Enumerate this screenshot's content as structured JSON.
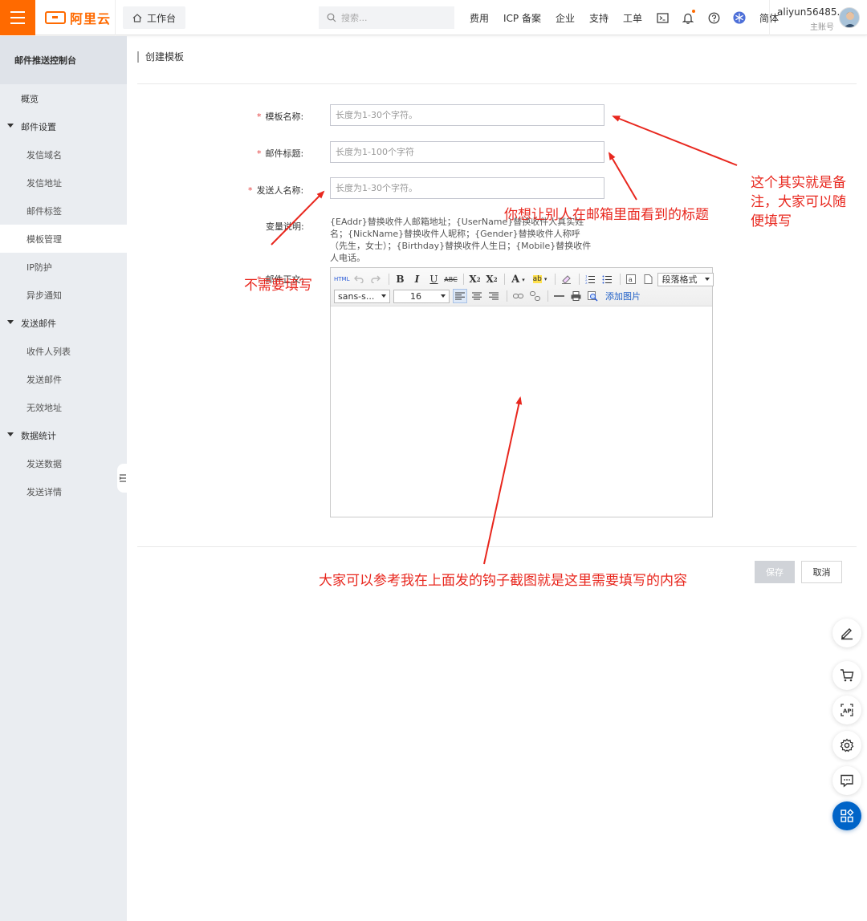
{
  "topbar": {
    "logo_text": "阿里云",
    "workbench_label": "工作台",
    "search_placeholder": "搜索...",
    "nav_links": [
      "费用",
      "ICP 备案",
      "企业",
      "支持",
      "工单"
    ],
    "lang_label": "简体",
    "user_name": "aliyun56485....",
    "user_sub": "主账号"
  },
  "sidebar": {
    "title": "邮件推送控制台",
    "items": [
      {
        "label": "概览"
      },
      {
        "label": "邮件设置"
      },
      {
        "label": "发信域名"
      },
      {
        "label": "发信地址"
      },
      {
        "label": "邮件标签"
      },
      {
        "label": "模板管理"
      },
      {
        "label": "IP防护"
      },
      {
        "label": "异步通知"
      },
      {
        "label": "发送邮件"
      },
      {
        "label": "收件人列表"
      },
      {
        "label": "发送邮件"
      },
      {
        "label": "无效地址"
      },
      {
        "label": "数据统计"
      },
      {
        "label": "发送数据"
      },
      {
        "label": "发送详情"
      }
    ]
  },
  "page": {
    "title": "创建模板"
  },
  "form": {
    "required_mark": "*",
    "template_name": {
      "label": "模板名称:",
      "placeholder": "长度为1-30个字符。"
    },
    "subject": {
      "label": "邮件标题:",
      "placeholder": "长度为1-100个字符"
    },
    "sender_name": {
      "label": "发送人名称:",
      "placeholder": "长度为1-30个字符。"
    },
    "variables": {
      "label": "变量说明:",
      "text": "{EAddr}替换收件人邮箱地址；{UserName}替换收件人真实姓名；{NickName}替换收件人昵称；{Gender}替换收件人称呼（先生，女士）；{Birthday}替换收件人生日；{Mobile}替换收件人电话。"
    },
    "body": {
      "label": "邮件正文:"
    }
  },
  "editor": {
    "html_btn": "HTML",
    "font_family": "sans-s...",
    "font_size": "16",
    "paragraph_format": "段落格式",
    "add_image": "添加图片"
  },
  "actions": {
    "save": "保存",
    "cancel": "取消"
  },
  "annotations": {
    "note_remark": "这个其实就是备注，大家可以随便填写",
    "note_remark_line1": "这个其实就是备",
    "note_remark_line2": "注，大家可以随",
    "note_remark_line3": "便填写",
    "note_subject": "你想让别人在邮箱里面看到的标题",
    "note_sender": "不需要填写",
    "note_body": "大家可以参考我在上面发的钩子截图就是这里需要填写的内容"
  },
  "colors": {
    "brand": "#ff6a00",
    "annotation": "#e8271e",
    "primary": "#0064c8"
  }
}
